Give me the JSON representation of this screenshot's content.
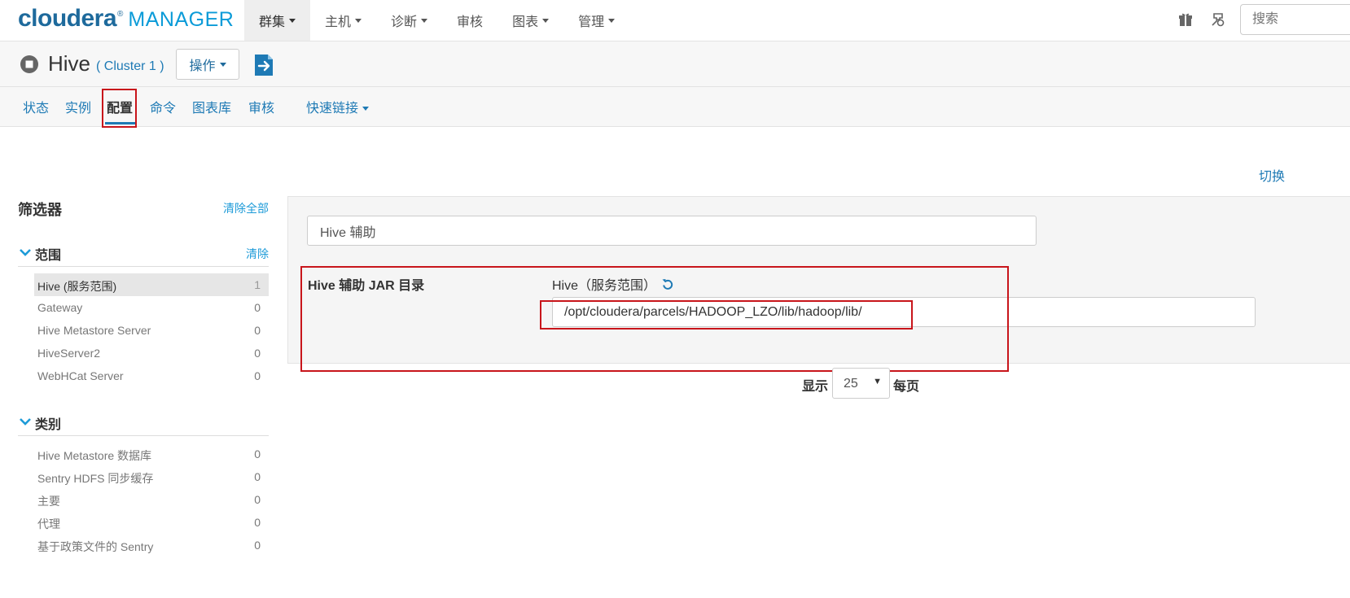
{
  "brand": {
    "name": "cloudera",
    "reg": "®",
    "product": "MANAGER"
  },
  "topnav": [
    {
      "label": "群集",
      "active": true
    },
    {
      "label": "主机",
      "active": false
    },
    {
      "label": "诊断",
      "active": false
    },
    {
      "label": "审核",
      "active": false
    },
    {
      "label": "图表",
      "active": false
    },
    {
      "label": "管理",
      "active": false
    }
  ],
  "search": {
    "placeholder": "搜索"
  },
  "service": {
    "name": "Hive",
    "cluster": "( Cluster 1 )",
    "actions_label": "操作"
  },
  "subtabs": [
    {
      "label": "状态"
    },
    {
      "label": "实例"
    },
    {
      "label": "配置"
    },
    {
      "label": "命令"
    },
    {
      "label": "图表库"
    },
    {
      "label": "审核"
    },
    {
      "label": "快速链接"
    }
  ],
  "switch_link": "切换",
  "filters": {
    "title": "筛选器",
    "clear_all": "清除全部",
    "scope": {
      "label": "范围",
      "clear": "清除",
      "items": [
        {
          "label": "Hive (服务范围)",
          "count": "1"
        },
        {
          "label": "Gateway",
          "count": "0"
        },
        {
          "label": "Hive Metastore Server",
          "count": "0"
        },
        {
          "label": "HiveServer2",
          "count": "0"
        },
        {
          "label": "WebHCat Server",
          "count": "0"
        }
      ]
    },
    "category": {
      "label": "类别",
      "items": [
        {
          "label": "Hive Metastore 数据库",
          "count": "0"
        },
        {
          "label": "Sentry HDFS 同步缓存",
          "count": "0"
        },
        {
          "label": "主要",
          "count": "0"
        },
        {
          "label": "代理",
          "count": "0"
        },
        {
          "label": "基于政策文件的 Sentry",
          "count": "0"
        }
      ]
    }
  },
  "config": {
    "search_value": "Hive 辅助",
    "property": {
      "label": "Hive 辅助 JAR 目录",
      "scope": "Hive（服务范围）",
      "value": "/opt/cloudera/parcels/HADOOP_LZO/lib/hadoop/lib/"
    }
  },
  "pagination": {
    "show": "显示",
    "per_page_value": "25",
    "per_page": "每页"
  },
  "colors": {
    "link": "#1e7ab5",
    "accent": "#1e9bd8",
    "highlight": "#c8151b",
    "brand": "#1e6a9c"
  }
}
